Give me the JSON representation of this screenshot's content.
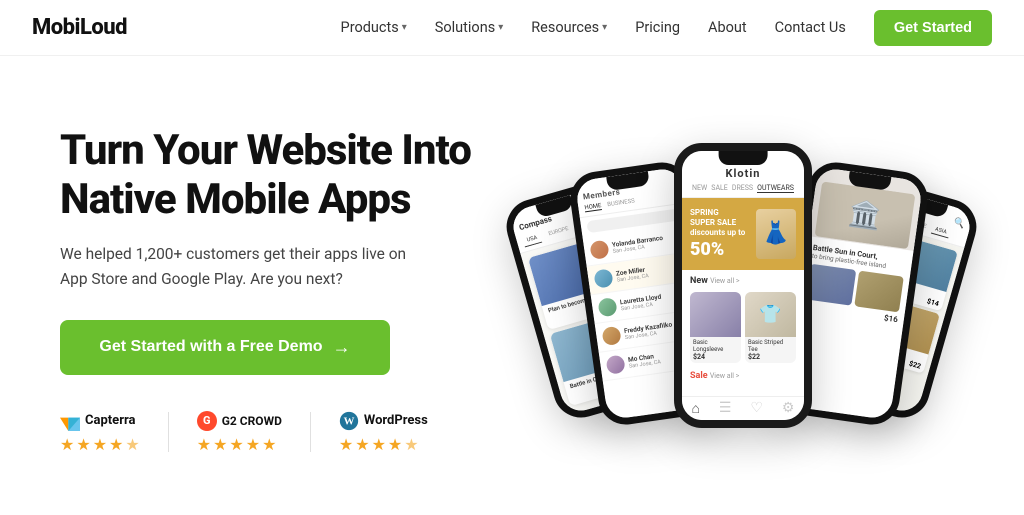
{
  "brand": {
    "name": "MobiLoud"
  },
  "navbar": {
    "links": [
      {
        "label": "Products",
        "has_dropdown": true
      },
      {
        "label": "Solutions",
        "has_dropdown": true
      },
      {
        "label": "Resources",
        "has_dropdown": true
      },
      {
        "label": "Pricing",
        "has_dropdown": false
      },
      {
        "label": "About",
        "has_dropdown": false
      },
      {
        "label": "Contact Us",
        "has_dropdown": false
      }
    ],
    "cta_label": "Get Started"
  },
  "hero": {
    "title_line1": "Turn Your Website Into",
    "title_line2": "Native Mobile Apps",
    "subtitle": "We helped 1,200+ customers get their apps live on App Store and Google Play. Are you next?",
    "cta_label": "Get Started with a Free Demo",
    "cta_arrow": "→"
  },
  "badges": [
    {
      "platform": "Capterra",
      "icon_type": "capterra",
      "stars": 4.5
    },
    {
      "platform": "G2 CROWD",
      "icon_type": "g2",
      "stars": 5
    },
    {
      "platform": "WordPress",
      "icon_type": "wordpress",
      "stars": 4.5
    }
  ],
  "phones": {
    "center_label": "Klotin - Fashion App",
    "left1_label": "Members App",
    "right1_label": "Compass Travel App"
  }
}
